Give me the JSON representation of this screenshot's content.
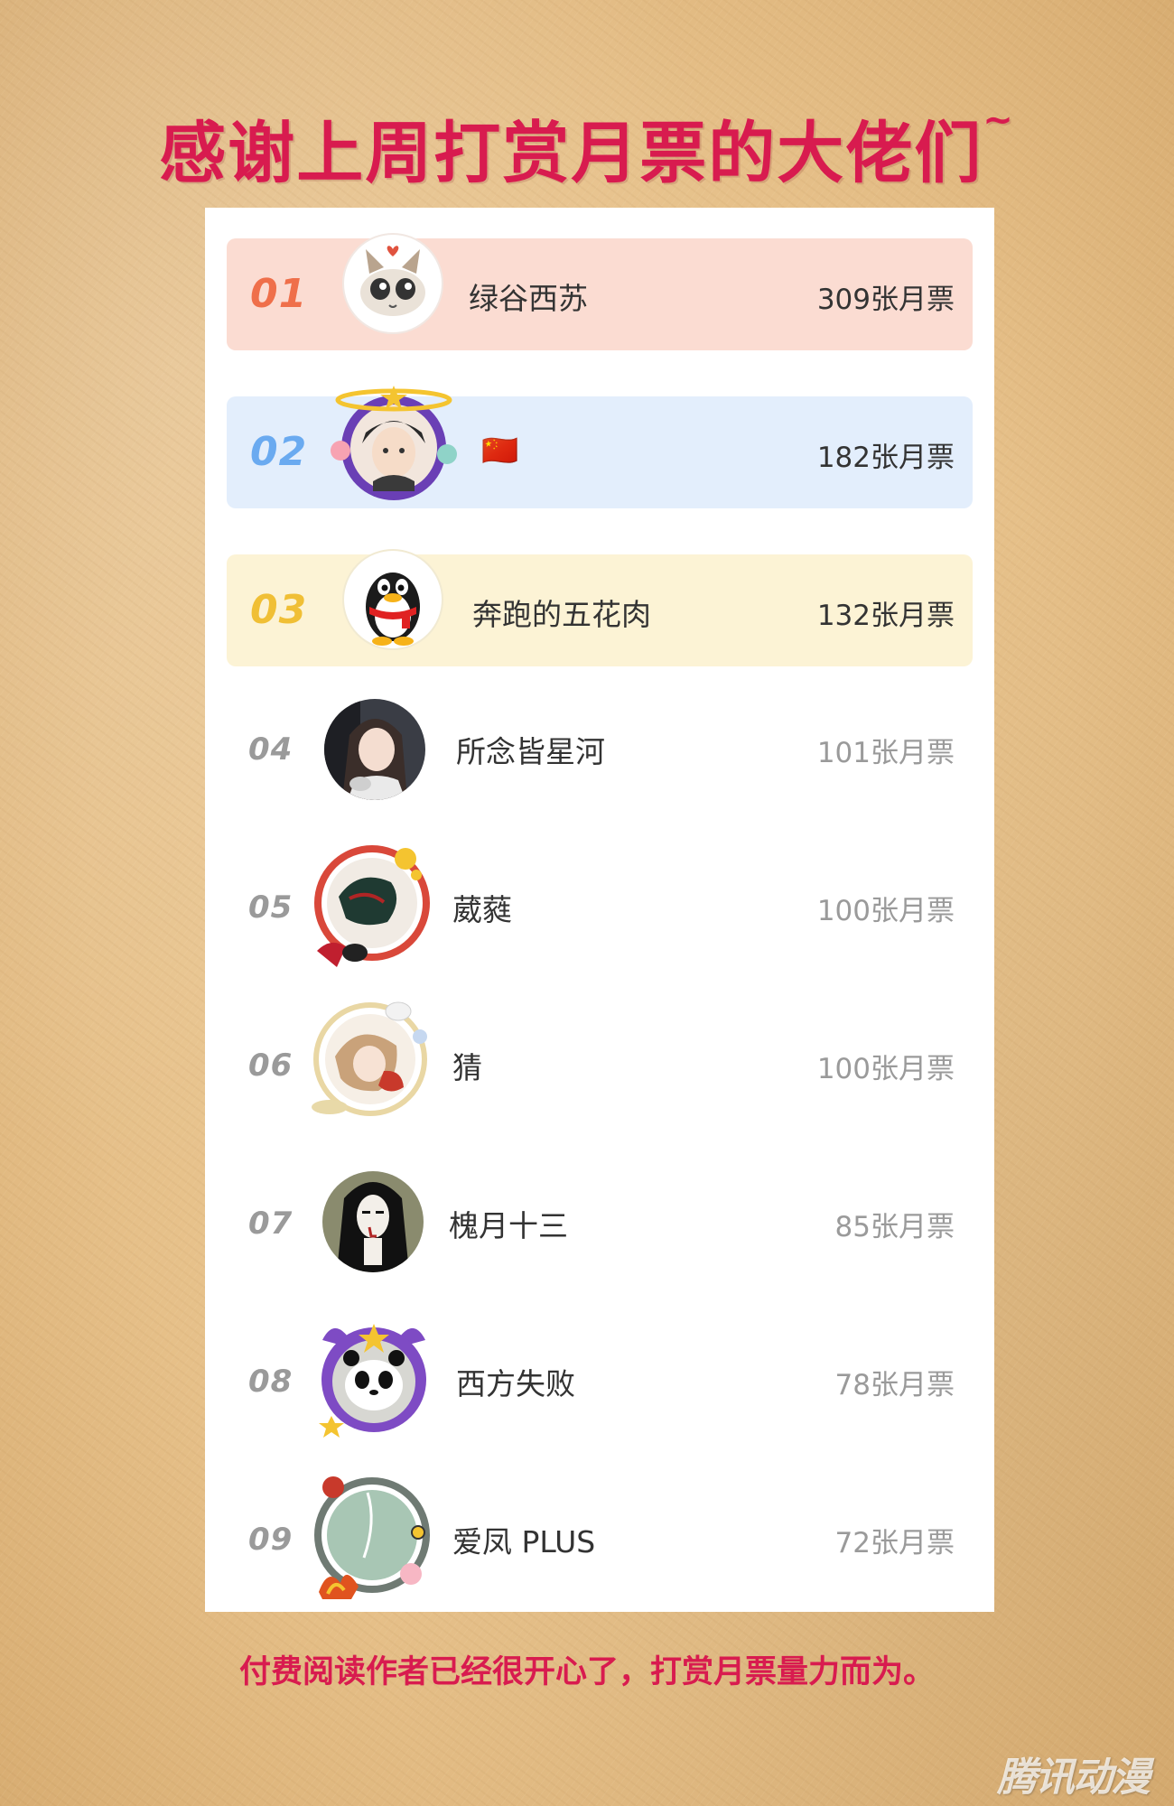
{
  "title": "感谢上周打赏月票的大佬们",
  "title_suffix": "~",
  "ranking": [
    {
      "rank": "01",
      "name": "绿谷西苏",
      "votes": "309张月票"
    },
    {
      "rank": "02",
      "name": "🇨🇳",
      "votes": "182张月票"
    },
    {
      "rank": "03",
      "name": "奔跑的五花肉",
      "votes": "132张月票"
    },
    {
      "rank": "04",
      "name": "所念皆星河",
      "votes": "101张月票"
    },
    {
      "rank": "05",
      "name": "葳蕤",
      "votes": "100张月票"
    },
    {
      "rank": "06",
      "name": "猜",
      "votes": "100张月票"
    },
    {
      "rank": "07",
      "name": "槐月十三",
      "votes": "85张月票"
    },
    {
      "rank": "08",
      "name": "西方失败",
      "votes": "78张月票"
    },
    {
      "rank": "09",
      "name": "爱凤 PLUS",
      "votes": "72张月票"
    }
  ],
  "footer": "付费阅读作者已经很开心了，打赏月票量力而为。",
  "watermark": "腾讯动漫",
  "colors": {
    "title": "#d81b4f",
    "rank1": "#ef6f4a",
    "rank2": "#6aaaf0",
    "rank3": "#f0bf35",
    "row1_bg": "#fbdcd2",
    "row2_bg": "#e3eefc",
    "row3_bg": "#fcf3d5"
  },
  "icons": {
    "row1": "cat-avatar-icon",
    "row2": "anime-boy-avatar-icon",
    "row3": "qq-penguin-avatar-icon",
    "row4": "girl-photo-avatar-icon",
    "row5": "decorated-avatar-icon",
    "row6": "decorated-avatar-icon",
    "row7": "girl-drawing-avatar-icon",
    "row8": "panda-avatar-icon",
    "row9": "decorated-avatar-icon"
  }
}
